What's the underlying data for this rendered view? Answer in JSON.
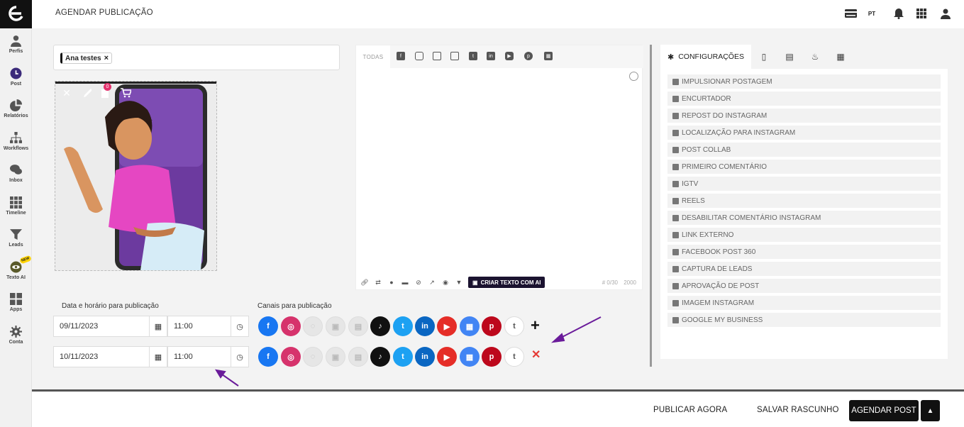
{
  "app": {
    "page_title": "AGENDAR PUBLICAÇÃO",
    "language": "PT"
  },
  "sidebar": {
    "items": [
      {
        "label": "Perfis",
        "icon": "person-icon"
      },
      {
        "label": "Post",
        "icon": "clock-icon"
      },
      {
        "label": "Relatórios",
        "icon": "pie-chart-icon"
      },
      {
        "label": "Workflows",
        "icon": "sitemap-icon"
      },
      {
        "label": "Inbox",
        "icon": "chat-icon"
      },
      {
        "label": "Timeline",
        "icon": "grid-icon"
      },
      {
        "label": "Leads",
        "icon": "filter-icon"
      },
      {
        "label": "Texto AI",
        "icon": "eye-ai-icon",
        "badge": "NEW"
      },
      {
        "label": "Apps",
        "icon": "apps-icon"
      },
      {
        "label": "Conta",
        "icon": "gear-icon"
      }
    ]
  },
  "profile_select": {
    "chip": "Ana testes",
    "chip_remove": "×"
  },
  "media": {
    "badge_count": "0"
  },
  "editor": {
    "tab_all": "TODAS",
    "ai_button": "CRIAR TEXTO COM AI",
    "counter": "# 0/30",
    "max_chars": "2000"
  },
  "schedule": {
    "date_label": "Data e horário para publicação",
    "channels_label": "Canais para publicação",
    "rows": [
      {
        "date": "09/11/2023",
        "time": "11:00",
        "action": "+"
      },
      {
        "date": "10/11/2023",
        "time": "11:00",
        "action": "✕"
      }
    ]
  },
  "config": {
    "active_tab": "CONFIGURAÇÕES",
    "options": [
      "IMPULSIONAR POSTAGEM",
      "ENCURTADOR",
      "REPOST DO INSTAGRAM",
      "LOCALIZAÇÃO PARA INSTAGRAM",
      "POST COLLAB",
      "PRIMEIRO COMENTÁRIO",
      "IGTV",
      "REELS",
      "DESABILITAR COMENTÁRIO INSTAGRAM",
      "LINK EXTERNO",
      "FACEBOOK POST 360",
      "CAPTURA DE LEADS",
      "APROVAÇÃO DE POST",
      "IMAGEM INSTAGRAM",
      "GOOGLE MY BUSINESS"
    ]
  },
  "footer": {
    "publish_now": "PUBLICAR AGORA",
    "save_draft": "SALVAR RASCUNHO",
    "schedule_post": "AGENDAR POST"
  },
  "colors": {
    "facebook": "#1877f2",
    "instagram": "#d6336c",
    "tiktok": "#111111",
    "twitter": "#1da1f2",
    "linkedin": "#0a66c2",
    "youtube": "#e52d27",
    "gmb": "#4285f4",
    "pinterest": "#bd081c",
    "annotation_arrow": "#6a1b9a"
  }
}
